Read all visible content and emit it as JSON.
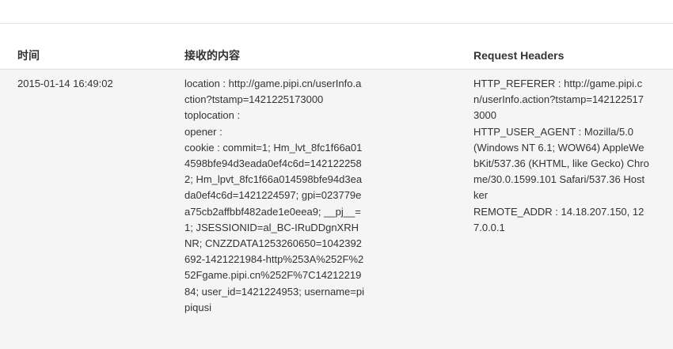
{
  "table": {
    "headers": {
      "time": "时间",
      "content": "接收的内容",
      "request_headers": "Request Headers"
    },
    "rows": [
      {
        "time": "2015-01-14 16:49:02",
        "content_lines": [
          "location : http://game.pipi.cn/userInfo.action?tstamp=1421225173000",
          "toplocation :",
          "opener :",
          "cookie : commit=1; Hm_lvt_8fc1f66a014598bfe94d3eada0ef4c6d=1421222582; Hm_lpvt_8fc1f66a014598bfe94d3eada0ef4c6d=1421224597; gpi=023779ea75cb2affbbf482ade1e0eea9; __pj__=1; JSESSIONID=al_BC-IRuDDgnXRHNR; CNZZDATA1253260650=1042392692-1421221984-http%253A%252F%252Fgame.pipi.cn%252F%7C1421221984; user_id=1421224953; username=pipiqusi"
        ],
        "header_lines": [
          "HTTP_REFERER : http://game.pipi.cn/userInfo.action?tstamp=1421225173000",
          "HTTP_USER_AGENT : Mozilla/5.0 (Windows NT 6.1; WOW64) AppleWebKit/537.36 (KHTML, like Gecko) Chrome/30.0.1599.101 Safari/537.36 Hostker",
          "REMOTE_ADDR : 14.18.207.150, 127.0.0.1"
        ]
      }
    ]
  }
}
